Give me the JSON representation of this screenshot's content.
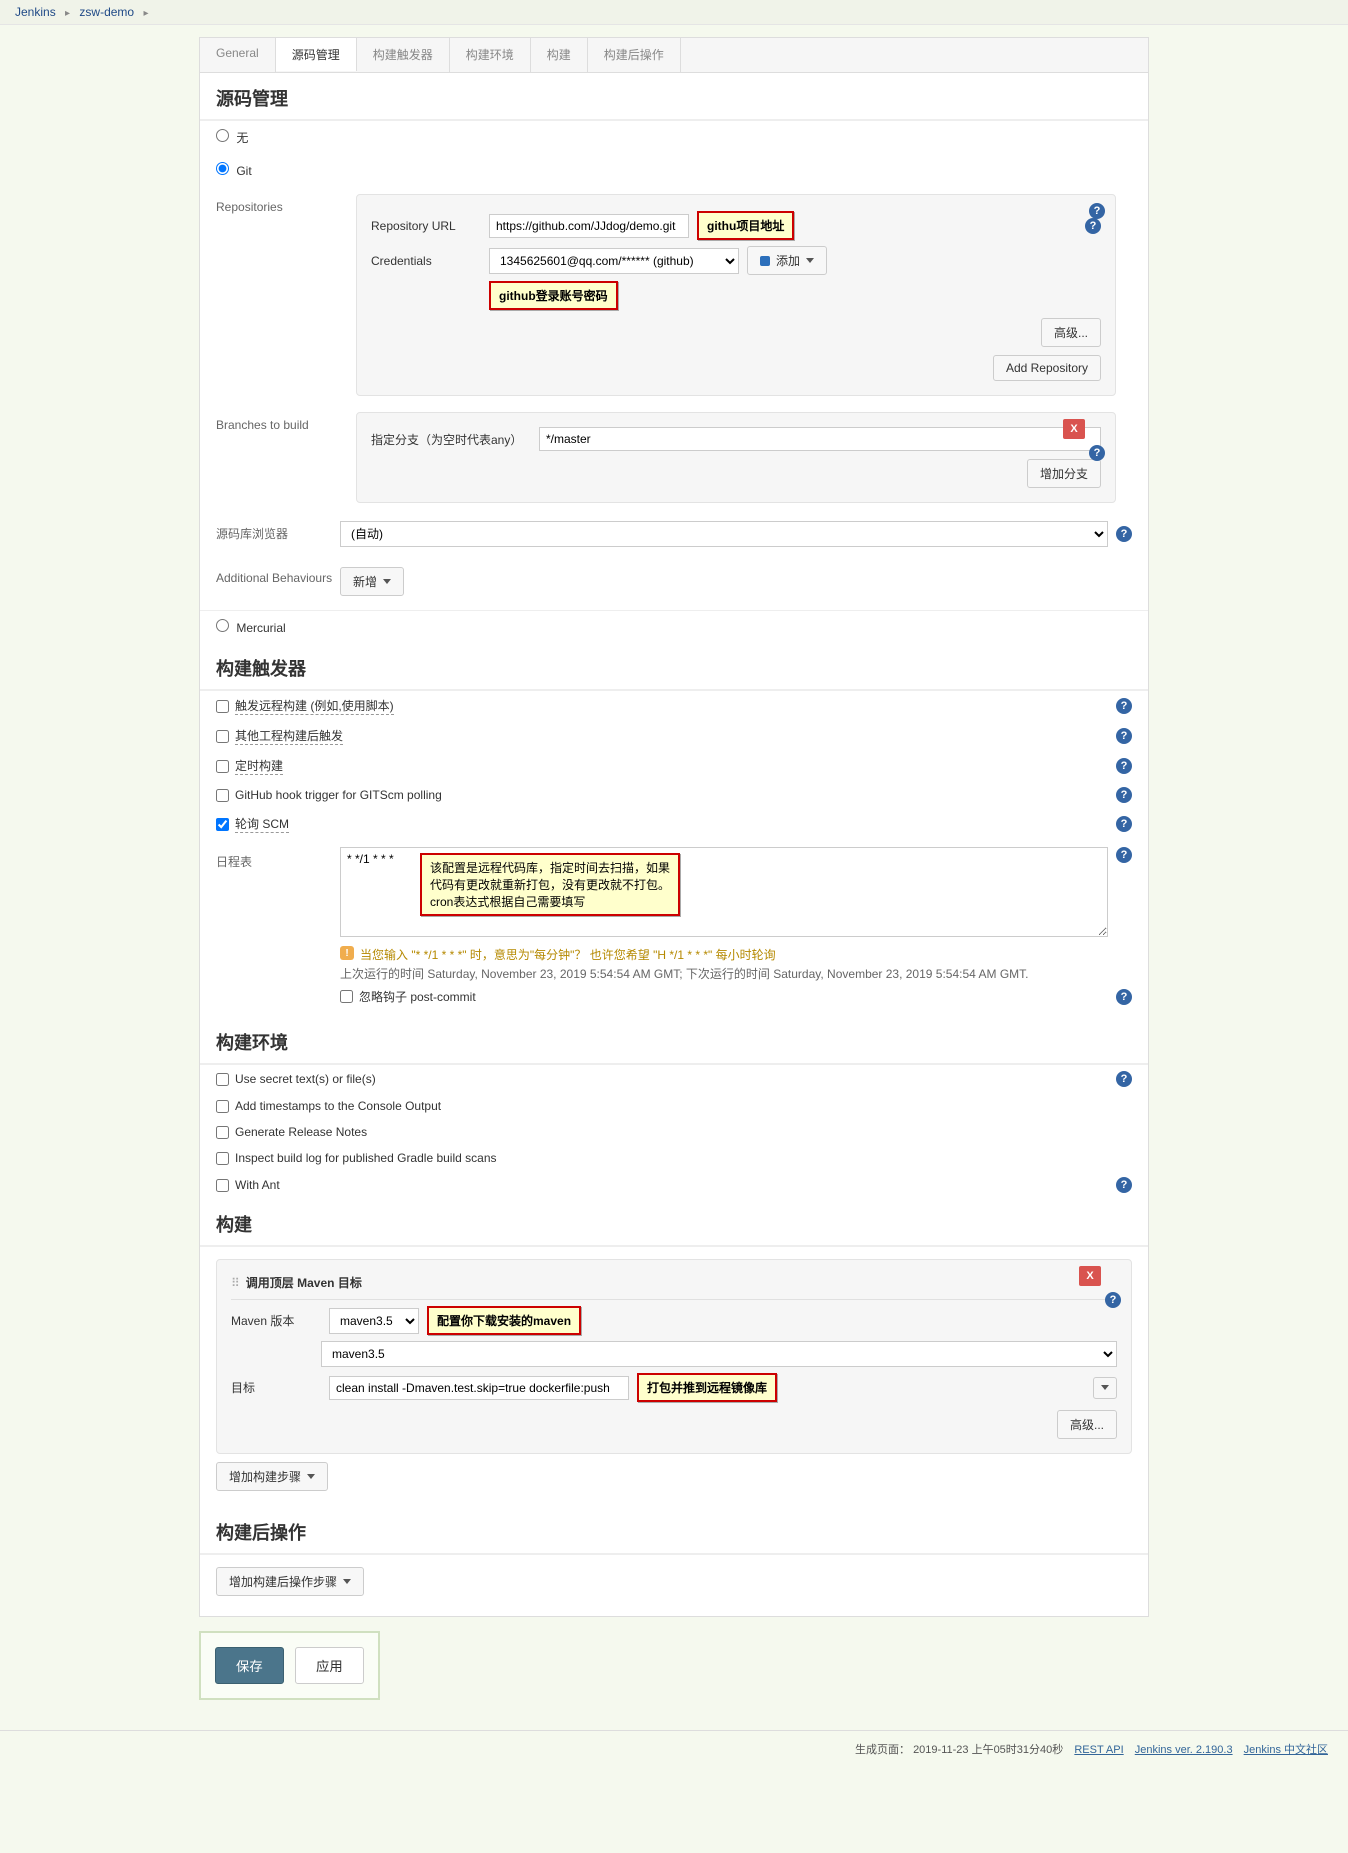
{
  "breadcrumb": {
    "root": "Jenkins",
    "job": "zsw-demo"
  },
  "tabs": {
    "general": "General",
    "scm": "源码管理",
    "triggers": "构建触发器",
    "env": "构建环境",
    "build": "构建",
    "post": "构建后操作"
  },
  "scm": {
    "heading": "源码管理",
    "none_label": "无",
    "git_label": "Git",
    "mercurial_label": "Mercurial",
    "repositories_label": "Repositories",
    "repo_url_label": "Repository URL",
    "repo_url_value": "https://github.com/JJdog/demo.git",
    "credentials_label": "Credentials",
    "credentials_value": "1345625601@qq.com/****** (github)",
    "add_cred_label": "添加",
    "advanced_btn": "高级...",
    "add_repo_btn": "Add Repository",
    "branches_label": "Branches to build",
    "branch_spec_label": "指定分支（为空时代表any）",
    "branch_spec_value": "*/master",
    "add_branch_btn": "增加分支",
    "browser_label": "源码库浏览器",
    "browser_value": "(自动)",
    "behaviours_label": "Additional Behaviours",
    "behaviours_add": "新增",
    "annot_repo": "githu项目地址",
    "annot_cred": "github登录账号密码"
  },
  "triggers": {
    "heading": "构建触发器",
    "remote": "触发远程构建 (例如,使用脚本)",
    "upstream": "其他工程构建后触发",
    "timer": "定时构建",
    "github_hook": "GitHub hook trigger for GITScm polling",
    "poll_scm": "轮询 SCM",
    "schedule_label": "日程表",
    "schedule_value": "* */1 * * *",
    "annot_schedule": "该配置是远程代码库，指定时间去扫描，如果代码有更改就重新打包，没有更改就不打包。\ncron表达式根据自己需要填写",
    "warn_text": "当您输入 \"* */1 * * *\" 时，意思为\"每分钟\"？ 也许您希望 \"H */1 * * *\" 每小时轮询",
    "runtime_text": "上次运行的时间 Saturday, November 23, 2019 5:54:54 AM GMT; 下次运行的时间 Saturday, November 23, 2019 5:54:54 AM GMT.",
    "ignore_hook_label": "忽略钩子 post-commit"
  },
  "env": {
    "heading": "构建环境",
    "secret": "Use secret text(s) or file(s)",
    "timestamps": "Add timestamps to the Console Output",
    "release_notes": "Generate Release Notes",
    "gradle_scan": "Inspect build log for published Gradle build scans",
    "with_ant": "With Ant"
  },
  "build": {
    "heading": "构建",
    "step_title": "调用顶层 Maven 目标",
    "maven_version_label": "Maven 版本",
    "maven_version_value": "maven3.5",
    "goals_label": "目标",
    "goals_value": "clean install -Dmaven.test.skip=true dockerfile:push",
    "advanced_btn": "高级...",
    "add_step_btn": "增加构建步骤",
    "annot_maven": "配置你下载安装的maven",
    "annot_goals": "打包并推到远程镜像库"
  },
  "post": {
    "heading": "构建后操作",
    "add_step_btn": "增加构建后操作步骤"
  },
  "footer_actions": {
    "save": "保存",
    "apply": "应用"
  },
  "page_footer": {
    "gen_label": "生成页面：",
    "timestamp": "2019-11-23  上午05时31分40秒",
    "rest_api": "REST API",
    "version": "Jenkins ver. 2.190.3",
    "community": "Jenkins 中文社区"
  }
}
